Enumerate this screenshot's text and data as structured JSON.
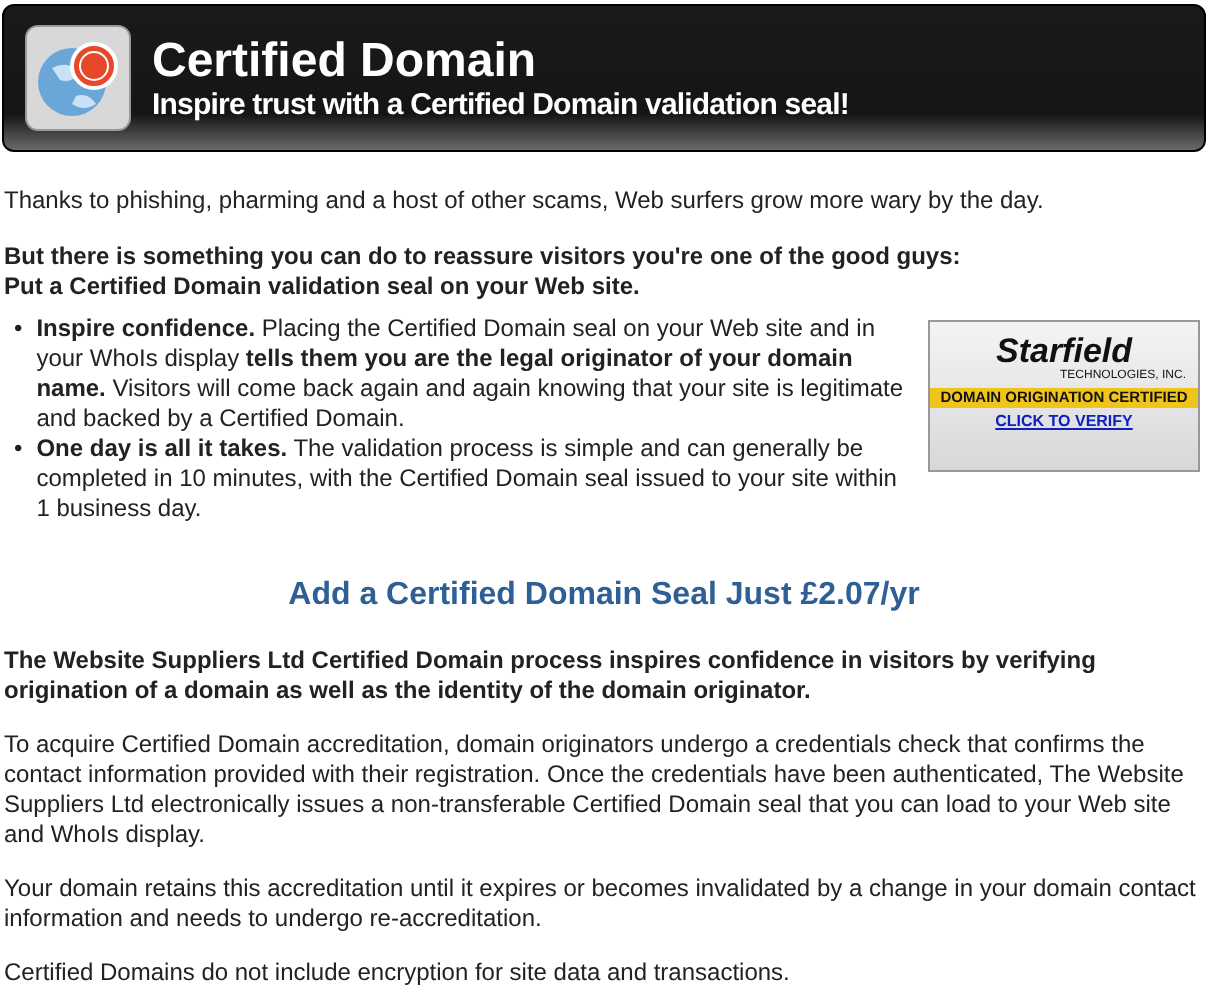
{
  "header": {
    "title": "Certified Domain",
    "subtitle": "Inspire trust with a Certified Domain validation seal!"
  },
  "intro": "Thanks to phishing, pharming and a host of other scams, Web surfers grow more wary by the day.",
  "lead": [
    "But there is something you can do to reassure visitors you're one of the good guys:",
    "Put a Certified Domain validation seal on your Web site."
  ],
  "seal": {
    "brand": "Starfield",
    "company": "TECHNOLOGIES, INC.",
    "banner": "DOMAIN ORIGINATION CERTIFIED",
    "link": "CLICK TO VERIFY"
  },
  "bullet_marker": "•",
  "bullets": [
    "**Inspire confidence.** Placing the Certified Domain seal on your Web site and in your WhoIs display **tells them you are the legal originator of your domain name.** Visitors will come back again and again knowing that your site is legitimate and backed by a Certified Domain.",
    "**One day is all it takes.** The validation process is simple and can generally be completed in 10 minutes, with the Certified Domain seal issued to your site within 1 business day."
  ],
  "offer": "Add a Certified Domain Seal Just £2.07/yr",
  "paragraphs": [
    {
      "kind": "bold",
      "text": "The Website Suppliers Ltd Certified Domain process inspires confidence in visitors by verifying origination of a domain as well as the identity of the domain originator."
    },
    {
      "kind": "plain",
      "text": "To acquire Certified Domain accreditation, domain originators undergo a credentials check that confirms the contact information provided with their registration. Once the credentials have been authenticated, The Website Suppliers Ltd electronically issues a non-transferable Certified Domain seal that you can load to your Web site and WhoIs display."
    },
    {
      "kind": "plain",
      "text": "Your domain retains this accreditation until it expires or becomes invalidated by a change in your domain contact information and needs to undergo re-accreditation."
    },
    {
      "kind": "plain",
      "text": "Certified Domains do not include encryption for site data and transactions."
    }
  ]
}
